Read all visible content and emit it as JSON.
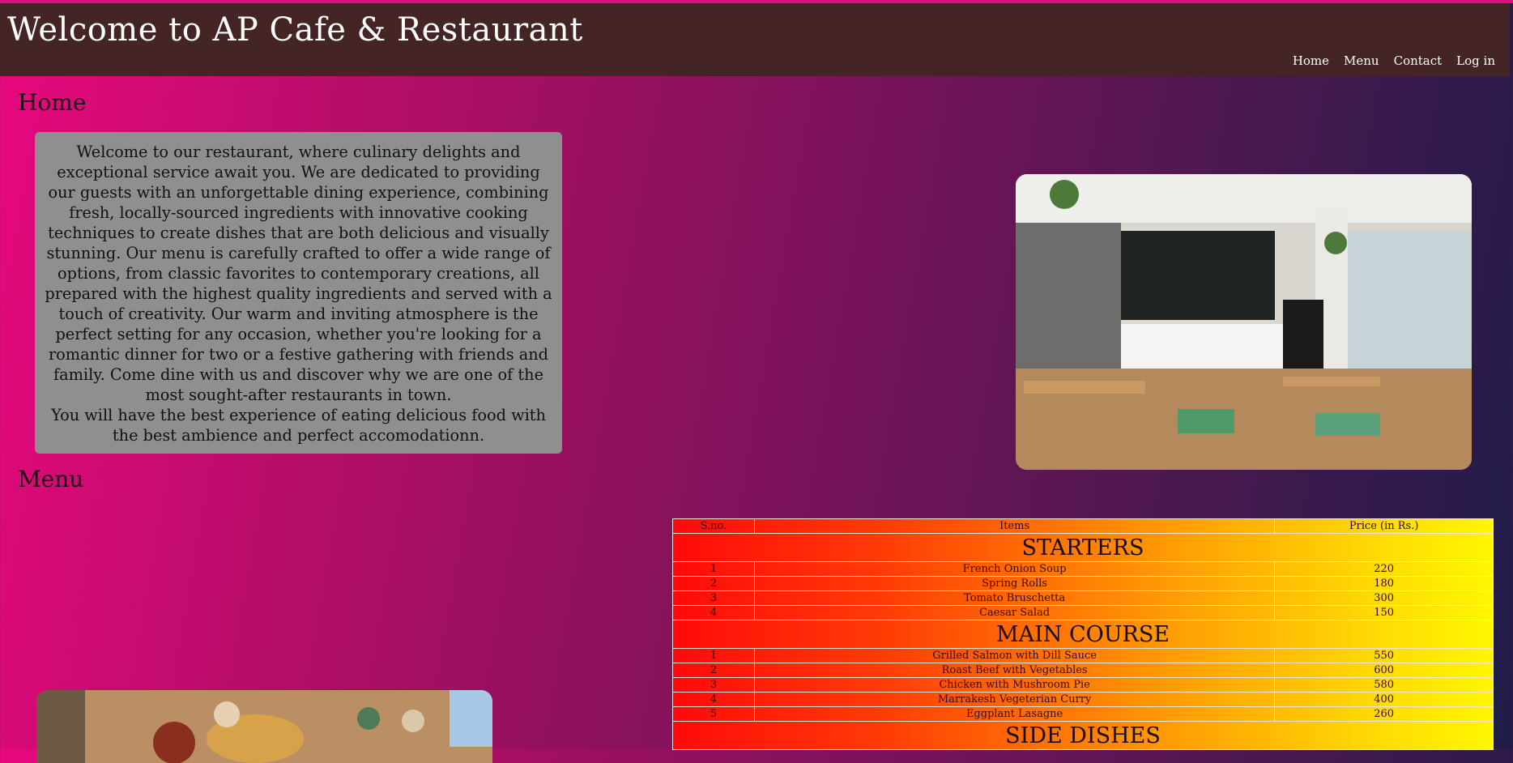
{
  "header": {
    "title": "Welcome to AP Cafe & Restaurant",
    "nav": [
      "Home",
      "Menu",
      "Contact",
      "Log in"
    ]
  },
  "home": {
    "title": "Home",
    "paragraph1": "Welcome to our restaurant, where culinary delights and exceptional service await you. We are dedicated to providing our guests with an unforgettable dining experience, combining fresh, locally-sourced ingredients with innovative cooking techniques to create dishes that are both delicious and visually stunning. Our menu is carefully crafted to offer a wide range of options, from classic favorites to contemporary creations, all prepared with the highest quality ingredients and served with a touch of creativity. Our warm and inviting atmosphere is the perfect setting for any occasion, whether you're looking for a romantic dinner for two or a festive gathering with friends and family. Come dine with us and discover why we are one of the most sought-after restaurants in town.",
    "paragraph2": "You will have the best experience of eating delicious food with the best ambience and perfect accomodationn."
  },
  "menu": {
    "title": "Menu",
    "columns": [
      "S.no.",
      "Items",
      "Price (in Rs.)"
    ],
    "categories": [
      {
        "name": "STARTERS",
        "items": [
          {
            "sno": "1",
            "name": "French Onion Soup",
            "price": "220"
          },
          {
            "sno": "2",
            "name": "Spring Rolls",
            "price": "180"
          },
          {
            "sno": "3",
            "name": "Tomato Bruschetta",
            "price": "300"
          },
          {
            "sno": "4",
            "name": "Caesar Salad",
            "price": "150"
          }
        ]
      },
      {
        "name": "MAIN COURSE",
        "items": [
          {
            "sno": "1",
            "name": "Grilled Salmon with Dill Sauce",
            "price": "550"
          },
          {
            "sno": "2",
            "name": "Roast Beef with Vegetables",
            "price": "600"
          },
          {
            "sno": "3",
            "name": "Chicken with Mushroom Pie",
            "price": "580"
          },
          {
            "sno": "4",
            "name": "Marrakesh Vegeterian Curry",
            "price": "400"
          },
          {
            "sno": "5",
            "name": "Eggplant Lasagne",
            "price": "260"
          }
        ]
      },
      {
        "name": "SIDE DISHES",
        "items": []
      }
    ]
  },
  "colors": {
    "header_bg": "#442424",
    "panel_bg": "#8f8f8f",
    "menu_gradient_start": "#ff0a0a",
    "menu_gradient_end": "#fff700"
  }
}
